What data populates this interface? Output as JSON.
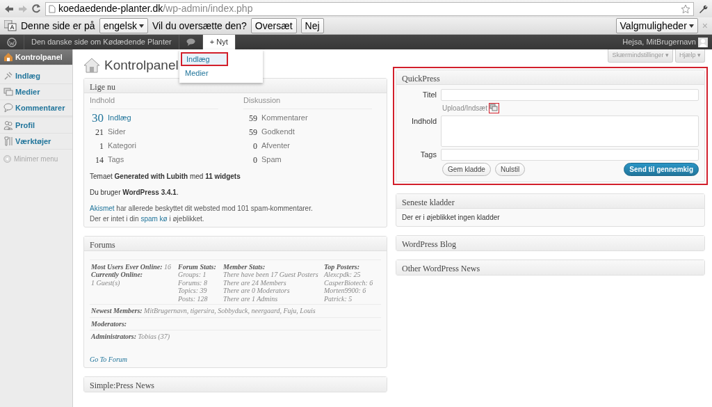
{
  "browser": {
    "url_host": "koedaedende-planter.dk",
    "url_path": "/wp-admin/index.php"
  },
  "translate_bar": {
    "text_before": "Denne side er på",
    "language": "engelsk",
    "question": "Vil du oversætte den?",
    "buttons": [
      "Oversæt",
      "Nej"
    ],
    "options": "Valgmuligheder",
    "close": "×"
  },
  "admin_bar": {
    "site": "Den danske side om Kødædende Planter",
    "new_label": "+ Nyt",
    "new_open": true,
    "greeting": "Hejsa, MitBrugernavn"
  },
  "new_menu": [
    {
      "label": "Indlæg",
      "highlighted": true
    },
    {
      "label": "Medier",
      "highlighted": false
    }
  ],
  "sidebar": {
    "items": [
      {
        "label": "Kontrolpanel",
        "selected": true
      },
      {
        "label": "Indlæg",
        "selected": false
      },
      {
        "label": "Medier",
        "selected": false
      },
      {
        "label": "Kommentarer",
        "selected": false
      },
      {
        "label": "Profil",
        "selected": false
      },
      {
        "label": "Værktøjer",
        "selected": false
      }
    ],
    "collapse": "Minimer menu"
  },
  "page_title": "Kontrolpanel",
  "screen_buttons": [
    "Skærmindstillinger ▾",
    "Hjælp ▾"
  ],
  "right_now": {
    "title": "Lige nu",
    "content": {
      "heading": "Indhold",
      "rows": [
        {
          "count": "30",
          "label": "Indlæg"
        },
        {
          "count": "21",
          "label": "Sider"
        },
        {
          "count": "1",
          "label": "Kategori"
        },
        {
          "count": "14",
          "label": "Tags"
        }
      ]
    },
    "discussion": {
      "heading": "Diskussion",
      "rows": [
        {
          "count": "59",
          "label": "Kommentarer"
        },
        {
          "count": "59",
          "label": "Godkendt"
        },
        {
          "count": "0",
          "label": "Afventer"
        },
        {
          "count": "0",
          "label": "Spam"
        }
      ]
    },
    "theme_line": "Temaet **Generated with Lubith** med **11 widgets**",
    "version_line": "Du bruger **WordPress 3.4.1**.",
    "akismet_lines": [
      {
        "link": "Akismet",
        "after": " har allerede beskyttet dit websted mod 101 spam-kommentarer."
      },
      {
        "before": "Der er intet i din ",
        "link": "spam kø",
        "after": " i øjeblikket."
      }
    ]
  },
  "forums": {
    "title": "Forums",
    "stats_columns": [
      [
        "**Most Users Ever Online:** 16",
        "**Currently Online:**",
        "1 Guest(s)"
      ],
      [
        "**Forum Stats:**",
        "Groups: 1",
        "Forums: 8",
        "Topics: 39",
        "Posts: 128"
      ],
      [
        "**Member Stats:**",
        "There have been 17 Guest Posters",
        "There are 24 Members",
        "There are 0 Moderators",
        "There are 1 Admins"
      ],
      [
        "**Top Posters:**",
        "Alexcpdk: 25",
        "CasperBiotech: 6",
        "Morten9900: 6",
        "Patrick: 5"
      ]
    ],
    "rows": [
      "**Newest Members:** MitBrugernavn, tigersira, Sobbyduck, neergaard, Fuju, Louis",
      "**Moderators:**",
      "**Administrators:** Tobias (37)"
    ],
    "link": "Go To Forum"
  },
  "simplepress_news": {
    "title": "Simple:Press News"
  },
  "quickpress": {
    "title": "QuickPress",
    "highlighted": true,
    "title_label": "Titel",
    "upload_label": "Upload/Indsæt",
    "upload_icon_highlighted": true,
    "content_label": "Indhold",
    "tags_label": "Tags",
    "buttons": [
      "Gem kladde",
      "Nulstil"
    ],
    "submit": "Send til gennemkig"
  },
  "recent_drafts": {
    "title": "Seneste kladder",
    "text": "Der er i øjeblikket ingen kladder"
  },
  "wordpress_blog": {
    "title": "WordPress Blog"
  },
  "other_news": {
    "title": "Other WordPress News"
  }
}
